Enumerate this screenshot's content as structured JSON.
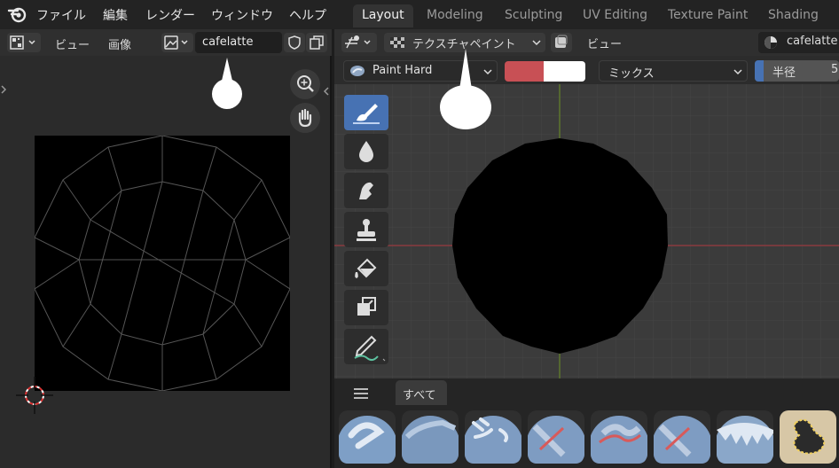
{
  "topbar": {
    "menus": [
      "ファイル",
      "編集",
      "レンダー",
      "ウィンドウ",
      "ヘルプ"
    ],
    "workspace_tabs": [
      "Layout",
      "Modeling",
      "Sculpting",
      "UV Editing",
      "Texture Paint",
      "Shading"
    ],
    "active_tab": "Layout"
  },
  "image_editor": {
    "view_label": "ビュー",
    "image_label": "画像",
    "image_name": "cafelatte"
  },
  "viewport": {
    "mode_label": "テクスチャペイント",
    "view_label": "ビュー",
    "material_name": "cafelatte",
    "brush_name": "Paint Hard",
    "blend_mode": "ミックス",
    "radius_label": "半径",
    "radius_value": "5",
    "primary_color": "#c85055",
    "secondary_color": "#ffffff",
    "brush_filter_label": "すべて"
  }
}
